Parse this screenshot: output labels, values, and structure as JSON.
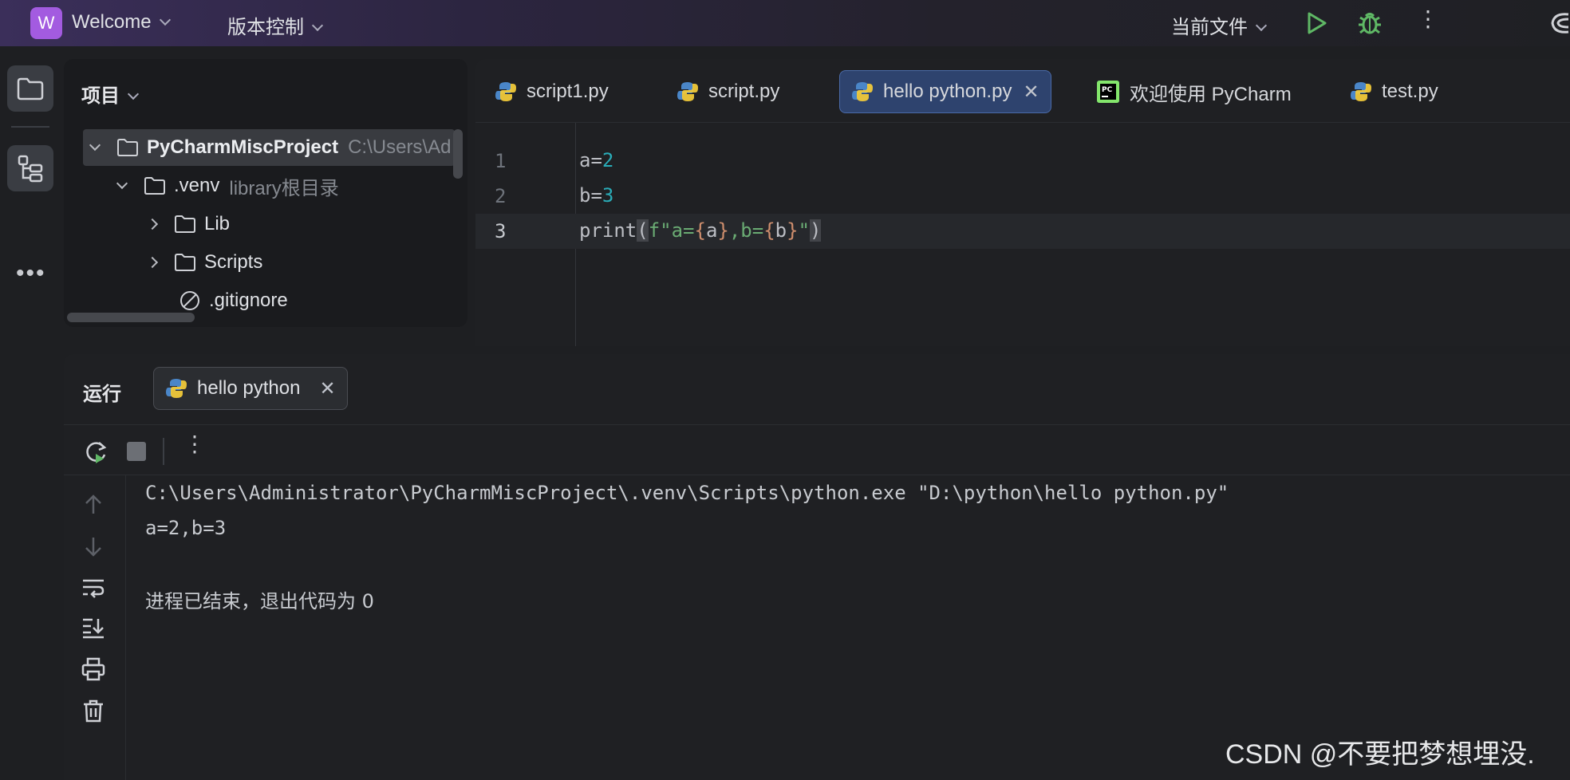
{
  "topbar": {
    "project_initial": "W",
    "project_name": "Welcome",
    "vcs_label": "版本控制",
    "run_config": "当前文件"
  },
  "project_panel": {
    "title": "项目",
    "tree": [
      {
        "label": "PyCharmMiscProject",
        "hint": "C:\\Users\\Ad"
      },
      {
        "label": ".venv",
        "hint": "library根目录"
      },
      {
        "label": "Lib"
      },
      {
        "label": "Scripts"
      },
      {
        "label": ".gitignore"
      }
    ]
  },
  "editor": {
    "tabs": [
      {
        "label": "script1.py"
      },
      {
        "label": "script.py"
      },
      {
        "label": "hello python.py"
      },
      {
        "label": "欢迎使用 PyCharm"
      },
      {
        "label": "test.py"
      }
    ],
    "lines": [
      {
        "num": "1",
        "var": "a",
        "op": "=",
        "val": "2"
      },
      {
        "num": "2",
        "var": "b",
        "op": "=",
        "val": "3"
      },
      {
        "num": "3",
        "fn": "print",
        "lp": "(",
        "prefix": "f\"a=",
        "lb1": "{",
        "a": "a",
        "rb1": "}",
        "mid": ",b=",
        "lb2": "{",
        "b": "b",
        "rb2": "}",
        "end": "\"",
        "rp": ")"
      }
    ]
  },
  "run_panel": {
    "title": "运行",
    "tab_label": "hello python",
    "console": [
      "C:\\Users\\Administrator\\PyCharmMiscProject\\.venv\\Scripts\\python.exe \"D:\\python\\hello python.py\"",
      "a=2,b=3",
      "进程已结束，退出代码为 0"
    ]
  },
  "watermark": "CSDN @不要把梦想埋没.",
  "colors": {
    "project_badge": "#a35be0",
    "run_green": "#5fb865",
    "active_tab": "#2e436e",
    "number": "#2aacb8",
    "string": "#6aab73",
    "brace": "#cf8e6d"
  }
}
